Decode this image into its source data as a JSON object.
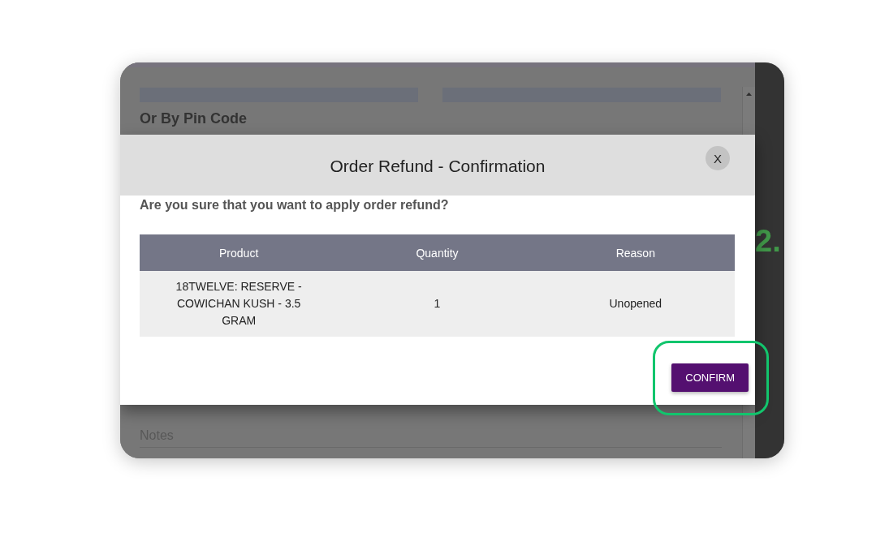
{
  "background_page": {
    "section_heading": "Or By Pin Code",
    "notes_field": {
      "placeholder": "Notes"
    },
    "side_panel": {
      "cut_off_text": "2."
    }
  },
  "dialog": {
    "title": "Order Refund - Confirmation",
    "close_label": "X",
    "message": "Are you sure that you want to apply order refund?",
    "table": {
      "columns": [
        "Product",
        "Quantity",
        "Reason"
      ],
      "rows": [
        [
          "18TWELVE: RESERVE - COWICHAN KUSH - 3.5 GRAM",
          "1",
          "Unopened"
        ]
      ]
    },
    "buttons": [
      {
        "label": "CONFIRM",
        "highlighted": true
      }
    ]
  }
}
